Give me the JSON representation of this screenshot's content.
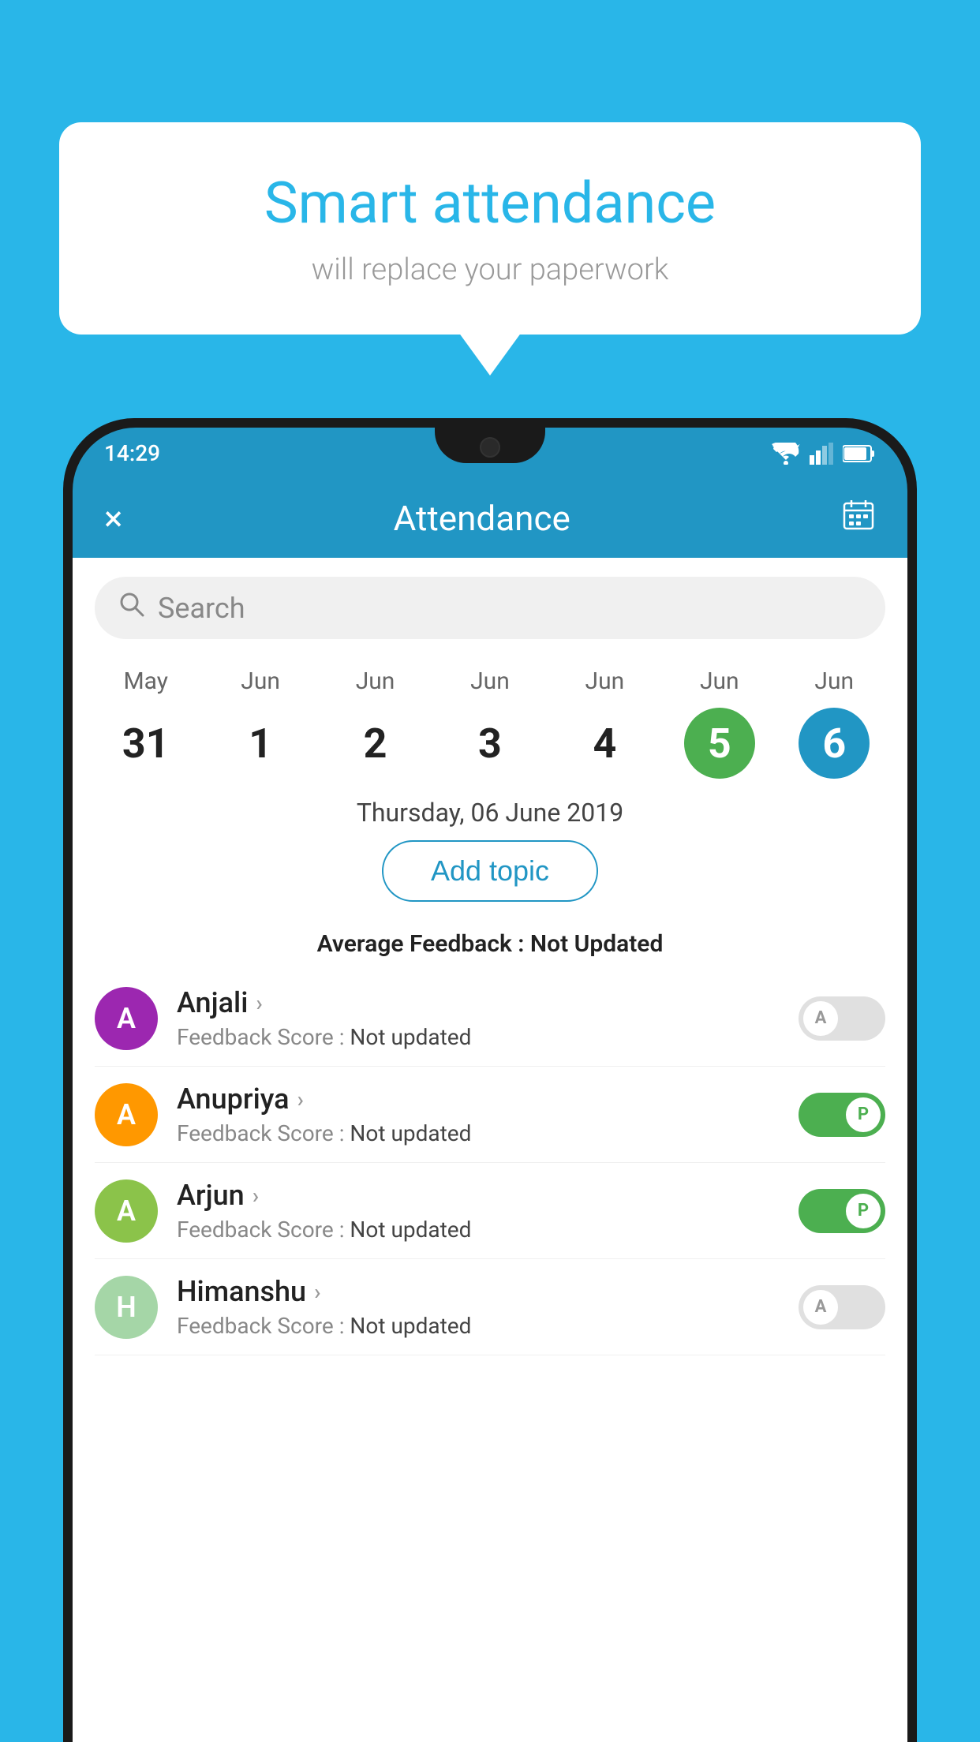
{
  "background_color": "#29b6e8",
  "speech_bubble": {
    "title": "Smart attendance",
    "subtitle": "will replace your paperwork"
  },
  "status_bar": {
    "time": "14:29"
  },
  "header": {
    "title": "Attendance",
    "close_label": "×",
    "calendar_label": "📅"
  },
  "search": {
    "placeholder": "Search"
  },
  "dates": [
    {
      "month": "May",
      "day": "31",
      "state": "normal"
    },
    {
      "month": "Jun",
      "day": "1",
      "state": "normal"
    },
    {
      "month": "Jun",
      "day": "2",
      "state": "normal"
    },
    {
      "month": "Jun",
      "day": "3",
      "state": "normal"
    },
    {
      "month": "Jun",
      "day": "4",
      "state": "normal"
    },
    {
      "month": "Jun",
      "day": "5",
      "state": "today"
    },
    {
      "month": "Jun",
      "day": "6",
      "state": "selected"
    }
  ],
  "selected_date_label": "Thursday, 06 June 2019",
  "add_topic_label": "Add topic",
  "avg_feedback_label": "Average Feedback : ",
  "avg_feedback_value": "Not Updated",
  "students": [
    {
      "name": "Anjali",
      "feedback_label": "Feedback Score : ",
      "feedback_value": "Not updated",
      "avatar_letter": "A",
      "avatar_color": "#9c27b0",
      "attendance": "absent"
    },
    {
      "name": "Anupriya",
      "feedback_label": "Feedback Score : ",
      "feedback_value": "Not updated",
      "avatar_letter": "A",
      "avatar_color": "#ff9800",
      "attendance": "present"
    },
    {
      "name": "Arjun",
      "feedback_label": "Feedback Score : ",
      "feedback_value": "Not updated",
      "avatar_letter": "A",
      "avatar_color": "#8bc34a",
      "attendance": "present"
    },
    {
      "name": "Himanshu",
      "feedback_label": "Feedback Score : ",
      "feedback_value": "Not updated",
      "avatar_letter": "H",
      "avatar_color": "#a5d6a7",
      "attendance": "absent"
    }
  ]
}
